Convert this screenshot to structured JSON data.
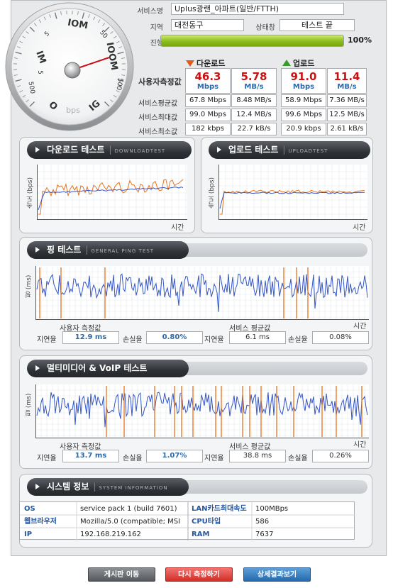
{
  "gauge": {
    "unit": "bps",
    "ticks": [
      "IM",
      "5",
      "IOM",
      "50",
      "IOOM",
      "500",
      "IG",
      "O",
      "500",
      "5"
    ],
    "needle_value_label": "100M"
  },
  "service": {
    "service_label": "서비스명",
    "service_value": "Uplus광랜_아파트(일반/FTTH)",
    "region_label": "지역",
    "region_value": "대전동구",
    "status_label": "상태창",
    "status_value": "테스트 끝",
    "progress_label": "진행",
    "progress_value": 1.0,
    "progress_text": "100%"
  },
  "stats": {
    "download_header": "다운로드",
    "upload_header": "업로드",
    "user_measured_label": "사용자측정값",
    "rows": [
      {
        "label": "서비스평균값",
        "values": [
          "67.8 Mbps",
          "8.48 MB/s",
          "58.9 Mbps",
          "7.36 MB/s"
        ]
      },
      {
        "label": "서비스최대값",
        "values": [
          "99.0 Mbps",
          "12.4 MB/s",
          "99.6 Mbps",
          "12.5 MB/s"
        ]
      },
      {
        "label": "서비스최소값",
        "values": [
          "182 kbps",
          "22.7 kB/s",
          "20.9 kbps",
          "2.61 kB/s"
        ]
      }
    ],
    "user": [
      {
        "num": "46.3",
        "unit": "Mbps"
      },
      {
        "num": "5.78",
        "unit": "MB/s"
      },
      {
        "num": "91.0",
        "unit": "Mbps"
      },
      {
        "num": "11.4",
        "unit": "MB/s"
      }
    ]
  },
  "download_test": {
    "title": "다운로드 테스트",
    "subtitle": "DOWNLOADTEST",
    "ylabel": "속도 (bps)",
    "xlabel": "시간"
  },
  "upload_test": {
    "title": "업로드 테스트",
    "subtitle": "UPLOADTEST",
    "ylabel": "속도 (bps)",
    "xlabel": "시간"
  },
  "ping_test": {
    "title": "핑 테스트",
    "subtitle": "GENERAL PING TEST",
    "ylabel": "핑 (ms)",
    "xlabel": "시간",
    "user_label": "사용자 측정값",
    "avg_label": "서비스 평균값",
    "latency_label": "지연율",
    "loss_label": "손실율",
    "user_latency": "12.9 ms",
    "user_loss": "0.80%",
    "avg_latency": "6.1 ms",
    "avg_loss": "0.08%"
  },
  "voip_test": {
    "title": "멀티미디어 & VoIP 테스트",
    "ylabel": "핑 (ms)",
    "xlabel": "시간",
    "user_label": "사용자 측정값",
    "avg_label": "서비스 평균값",
    "latency_label": "지연율",
    "loss_label": "손실율",
    "user_latency": "13.7 ms",
    "user_loss": "1.07%",
    "avg_latency": "38.8 ms",
    "avg_loss": "0.26%"
  },
  "system": {
    "title": "시스템 정보",
    "subtitle": "SYSTEM INFORMATION",
    "left": [
      {
        "key": "OS",
        "value": "service pack 1 (build 7601)"
      },
      {
        "key": "웹브라우저",
        "value": "Mozilla/5.0 (compatible; MSI"
      },
      {
        "key": "IP",
        "value": "192.168.219.162"
      }
    ],
    "right": [
      {
        "key": "LAN카드최대속도",
        "value": "100MBps"
      },
      {
        "key": "CPU타입",
        "value": "586"
      },
      {
        "key": "RAM",
        "value": "7637"
      }
    ]
  },
  "buttons": {
    "board": "게시판 이동",
    "retest": "다시 측정하기",
    "detail": "상세결과보기"
  },
  "colors": {
    "accent_red": "#cc1111",
    "accent_blue": "#2e6aa8",
    "series_orange": "#e8741c",
    "series_blue": "#3355cc",
    "progress_green": "#8cbd1c"
  }
}
